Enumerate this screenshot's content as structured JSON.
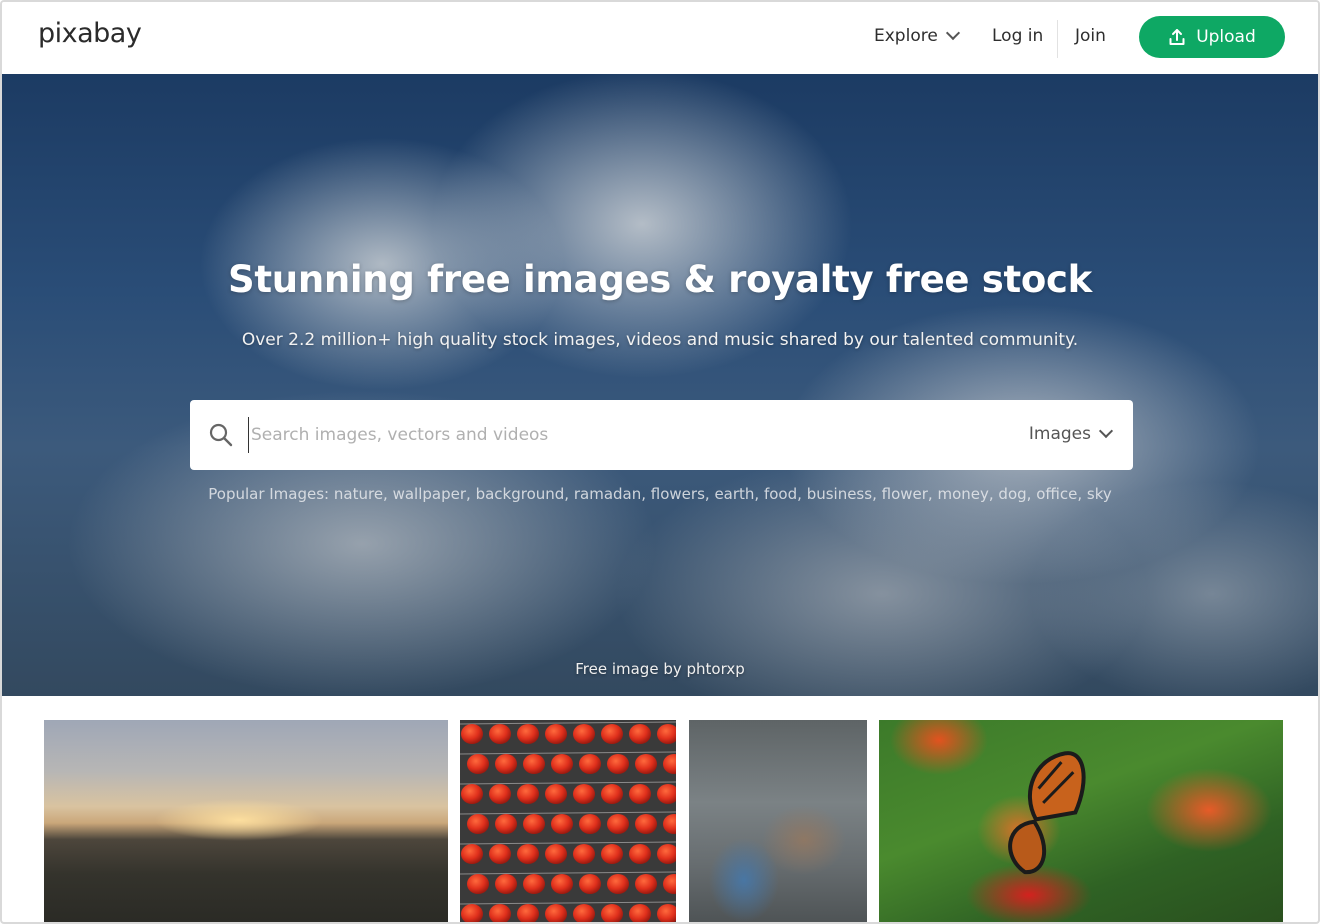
{
  "header": {
    "logo": "pixabay",
    "nav": {
      "explore": "Explore",
      "login": "Log in",
      "join": "Join",
      "upload": "Upload"
    }
  },
  "hero": {
    "title": "Stunning free images & royalty free stock",
    "subtitle": "Over 2.2 million+ high quality stock images, videos and music shared by our talented community.",
    "search": {
      "placeholder": "Search images, vectors and videos",
      "value": "",
      "type_selected": "Images"
    },
    "popular": {
      "label": "Popular Images:",
      "tags": [
        "nature",
        "wallpaper",
        "background",
        "ramadan",
        "flowers",
        "earth",
        "food",
        "business",
        "flower",
        "money",
        "dog",
        "office",
        "sky"
      ]
    },
    "credit": "Free image by phtorxp"
  },
  "colors": {
    "accent": "#0ea864",
    "hero_sky": "#1c3b63"
  },
  "icons": {
    "search": "search-icon",
    "upload": "upload-icon",
    "explore_dropdown": "chevron-down-icon",
    "type_dropdown": "chevron-down-icon"
  }
}
